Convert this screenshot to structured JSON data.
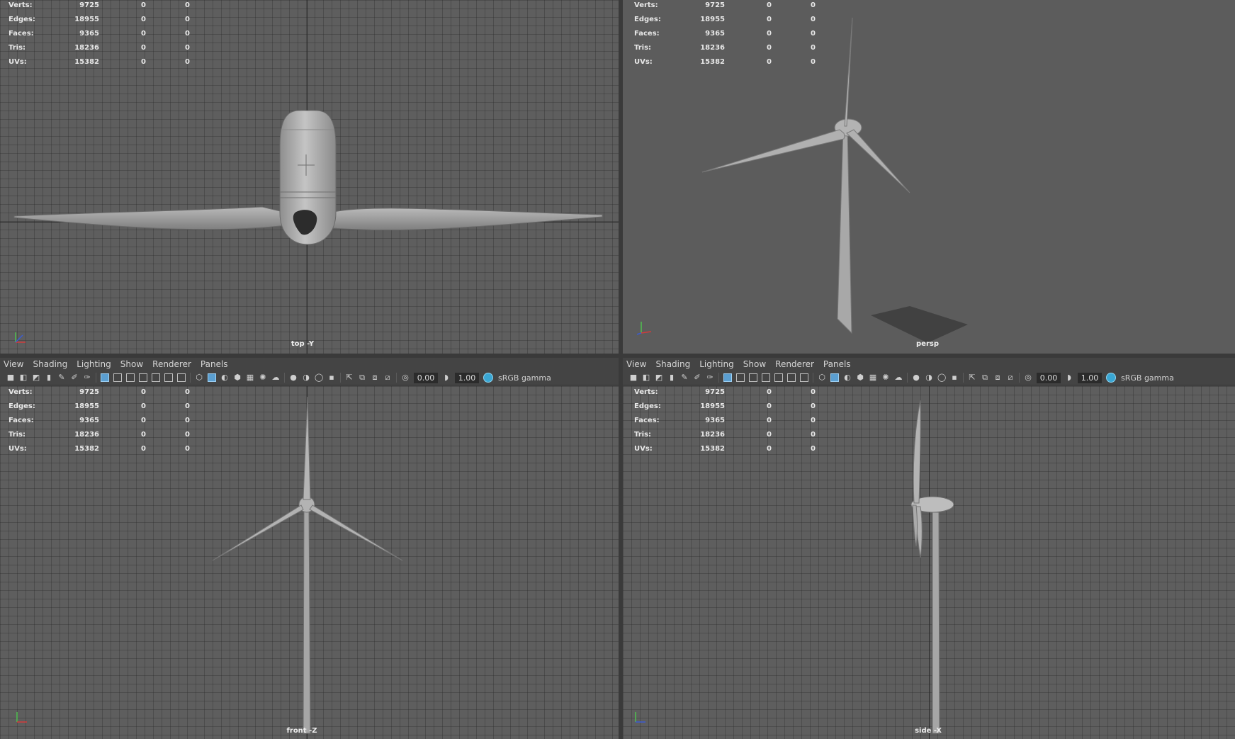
{
  "menus": [
    "View",
    "Shading",
    "Lighting",
    "Show",
    "Renderer",
    "Panels"
  ],
  "toolbar": {
    "exposure": "0.00",
    "gamma": "1.00",
    "color_space": "sRGB gamma"
  },
  "hud": [
    {
      "label": "Verts:",
      "v1": "9725",
      "v2": "0",
      "v3": "0"
    },
    {
      "label": "Edges:",
      "v1": "18955",
      "v2": "0",
      "v3": "0"
    },
    {
      "label": "Faces:",
      "v1": "9365",
      "v2": "0",
      "v3": "0"
    },
    {
      "label": "Tris:",
      "v1": "18236",
      "v2": "0",
      "v3": "0"
    },
    {
      "label": "UVs:",
      "v1": "15382",
      "v2": "0",
      "v3": "0"
    }
  ],
  "viewports": {
    "top": {
      "camera": "top -Y"
    },
    "persp": {
      "camera": "persp"
    },
    "front": {
      "camera": "front -Z"
    },
    "side": {
      "camera": "side -X"
    }
  },
  "colors": {
    "accent": "#5b9fd1",
    "model": "#a9a9a9",
    "grid": "#5e5e5e",
    "panel": "#444444"
  },
  "icons": {
    "axis_gizmo": "xyz-axis-icon",
    "color_management": "color-management-icon"
  }
}
